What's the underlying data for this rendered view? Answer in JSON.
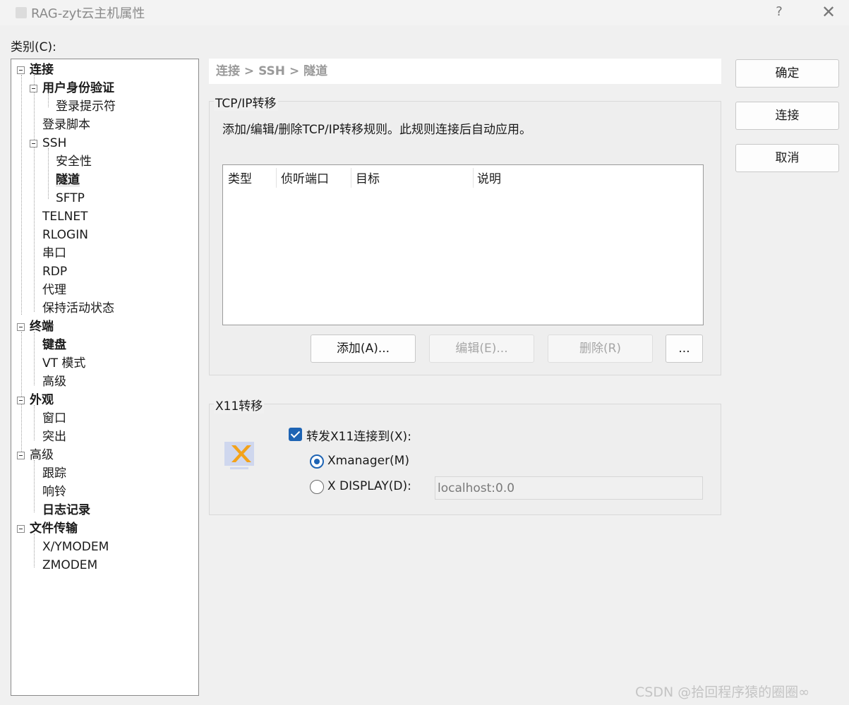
{
  "window": {
    "title": "RAG-zyt云主机属性",
    "help": "?",
    "close": "✕"
  },
  "category_label": "类别(C):",
  "tree": {
    "connection": "连接",
    "user_auth": "用户身份验证",
    "login_prompt": "登录提示符",
    "login_script": "登录脚本",
    "ssh": "SSH",
    "security": "安全性",
    "tunnel": "隧道",
    "sftp": "SFTP",
    "telnet": "TELNET",
    "rlogin": "RLOGIN",
    "serial": "串口",
    "rdp": "RDP",
    "proxy": "代理",
    "keepalive": "保持活动状态",
    "terminal": "终端",
    "keyboard": "键盘",
    "vt_mode": "VT 模式",
    "terminal_advanced": "高级",
    "appearance": "外观",
    "window": "窗口",
    "highlight": "突出",
    "advanced": "高级",
    "trace": "跟踪",
    "bell": "响铃",
    "logging": "日志记录",
    "file_transfer": "文件传输",
    "xymodem": "X/YMODEM",
    "zmodem": "ZMODEM"
  },
  "breadcrumb": "连接 > SSH > 隧道",
  "tcpip": {
    "group_title": "TCP/IP转移",
    "description": "添加/编辑/删除TCP/IP转移规则。此规则连接后自动应用。",
    "columns": [
      "类型",
      "侦听端口",
      "目标",
      "说明"
    ],
    "add": "添加(A)...",
    "edit": "编辑(E)...",
    "delete": "删除(R)",
    "more": "..."
  },
  "x11": {
    "group_title": "X11转移",
    "forward_label": "转发X11连接到(X):",
    "forward_checked": true,
    "xmanager": "Xmanager(M)",
    "xdisplay": "X DISPLAY(D):",
    "xdisplay_value": "localhost:0.0",
    "selected": "xmanager",
    "icon": "xmanager-icon"
  },
  "buttons": {
    "ok": "确定",
    "connect": "连接",
    "cancel": "取消"
  },
  "watermark": "CSDN @拾回程序猿的圈圈∞"
}
